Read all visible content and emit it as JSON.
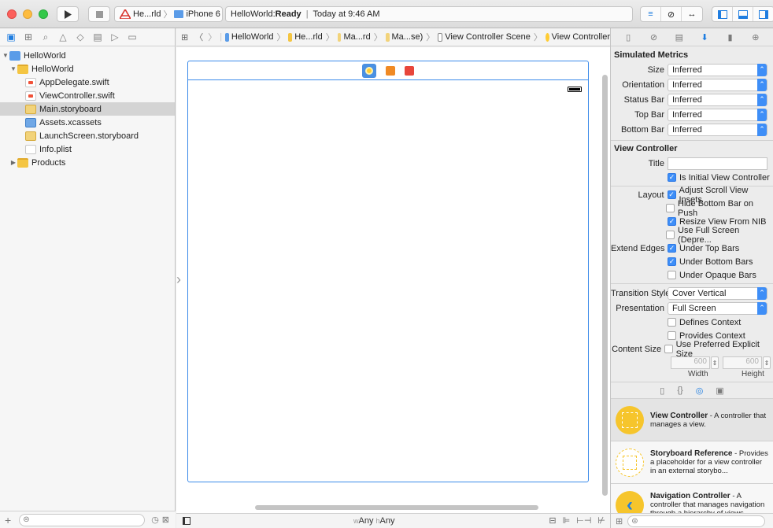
{
  "toolbar": {
    "run_icon": "play-icon",
    "stop_icon": "stop-icon",
    "scheme_name": "He...rld",
    "device": "iPhone 6",
    "status_app": "HelloWorld: ",
    "status_state": "Ready",
    "status_time": "Today at 9:46 AM"
  },
  "navigator": {
    "items": [
      {
        "label": "HelloWorld",
        "level": 0,
        "icon": "project-icon",
        "disclosure": "open"
      },
      {
        "label": "HelloWorld",
        "level": 1,
        "icon": "folder-icon",
        "disclosure": "open"
      },
      {
        "label": "AppDelegate.swift",
        "level": 2,
        "icon": "swift-file-icon"
      },
      {
        "label": "ViewController.swift",
        "level": 2,
        "icon": "swift-file-icon"
      },
      {
        "label": "Main.storyboard",
        "level": 2,
        "icon": "storyboard-icon",
        "selected": true
      },
      {
        "label": "Assets.xcassets",
        "level": 2,
        "icon": "asset-catalog-icon"
      },
      {
        "label": "LaunchScreen.storyboard",
        "level": 2,
        "icon": "storyboard-icon"
      },
      {
        "label": "Info.plist",
        "level": 2,
        "icon": "plist-icon"
      },
      {
        "label": "Products",
        "level": 1,
        "icon": "folder-icon",
        "disclosure": "closed"
      }
    ]
  },
  "jumpbar": {
    "crumbs": [
      "HelloWorld",
      "He...rld",
      "Ma...rd",
      "Ma...se)",
      "View Controller Scene",
      "View Controller"
    ]
  },
  "editor": {
    "size_w_prefix": "w",
    "size_w": "Any",
    "size_h_prefix": "h",
    "size_h": "Any"
  },
  "inspector": {
    "simulated_metrics_header": "Simulated Metrics",
    "metrics": [
      {
        "label": "Size",
        "value": "Inferred"
      },
      {
        "label": "Orientation",
        "value": "Inferred"
      },
      {
        "label": "Status Bar",
        "value": "Inferred"
      },
      {
        "label": "Top Bar",
        "value": "Inferred"
      },
      {
        "label": "Bottom Bar",
        "value": "Inferred"
      }
    ],
    "vc_header": "View Controller",
    "title_label": "Title",
    "title_value": "",
    "is_initial": "Is Initial View Controller",
    "layout_label": "Layout",
    "layout_opts": [
      {
        "label": "Adjust Scroll View Insets",
        "checked": true
      },
      {
        "label": "Hide Bottom Bar on Push",
        "checked": false
      },
      {
        "label": "Resize View From NIB",
        "checked": true
      },
      {
        "label": "Use Full Screen (Depre...",
        "checked": false
      }
    ],
    "extend_label": "Extend Edges",
    "extend_opts": [
      {
        "label": "Under Top Bars",
        "checked": true
      },
      {
        "label": "Under Bottom Bars",
        "checked": true
      },
      {
        "label": "Under Opaque Bars",
        "checked": false
      }
    ],
    "transition_label": "Transition Style",
    "transition_value": "Cover Vertical",
    "presentation_label": "Presentation",
    "presentation_value": "Full Screen",
    "defines_context": "Defines Context",
    "provides_context": "Provides Context",
    "content_size_label": "Content Size",
    "use_preferred": "Use Preferred Explicit Size",
    "width_value": "600",
    "height_value": "600",
    "width_label": "Width",
    "height_label": "Height"
  },
  "library": {
    "items": [
      {
        "title": "View Controller",
        "desc": " - A controller that manages a view.",
        "color": "#f6c52c"
      },
      {
        "title": "Storyboard Reference",
        "desc": " - Provides a placeholder for a view controller in an external storybo...",
        "color": "#ffffff"
      },
      {
        "title": "Navigation Controller",
        "desc": " - A controller that manages navigation through a hierarchy of views.",
        "color": "#f6c52c"
      }
    ]
  }
}
